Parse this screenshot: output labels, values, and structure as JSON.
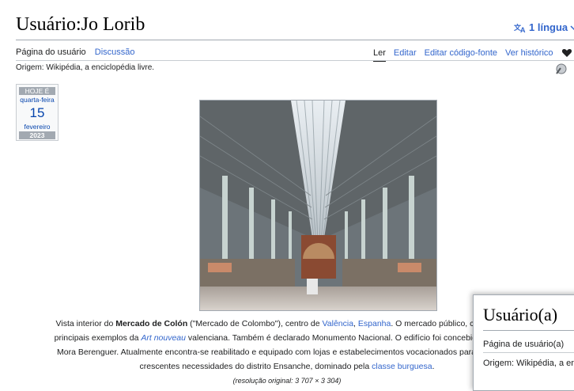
{
  "page": {
    "title": "Usuário:Jo Lorib",
    "language_button": "1 língua",
    "origin": "Origem: Wikipédia, a enciclopédia livre."
  },
  "tabs_left": [
    "Página do usuário",
    "Discussão"
  ],
  "tabs_right": [
    "Ler",
    "Editar",
    "Editar código-fonte",
    "Ver histórico"
  ],
  "calendar": {
    "header": "HOJE É",
    "weekday": "quarta-feira",
    "day": "15",
    "month": "fevereiro",
    "year": "2023"
  },
  "caption": {
    "l1_a": "Vista interior do ",
    "l1_b": "Mercado de Colón",
    "l1_c": " (\"Mercado de Colombo\"), centro de ",
    "l1_d": "Valência",
    "l1_e": ", ",
    "l1_f": "Espanha",
    "l1_g": ". O mercado público, construído er",
    "l2_a": "principais exemplos da ",
    "l2_b": "Art nouveau",
    "l2_c": " valenciana. Também é declarado Monumento Nacional. O edifício foi concebido e executa",
    "l3_a": "Mora Berenguer. Atualmente encontra-se reabilitado e equipado com lojas e estabelecimentos vocacionados para a ",
    "l3_b": "hotelaria",
    "l4_a": "crescentes necessidades do distrito Ensanche, dominado pela ",
    "l4_b": "classe burguesa",
    "l4_c": ".",
    "resolution": "(resolução original: 3 707 × 3 304)"
  },
  "overlay": {
    "title": "Usuário(a)",
    "tab": "Página de usuário(a)",
    "origin": "Origem: Wikipédia, a en"
  },
  "colors": {
    "link": "#3366cc",
    "rule": "#a2a9b1"
  }
}
